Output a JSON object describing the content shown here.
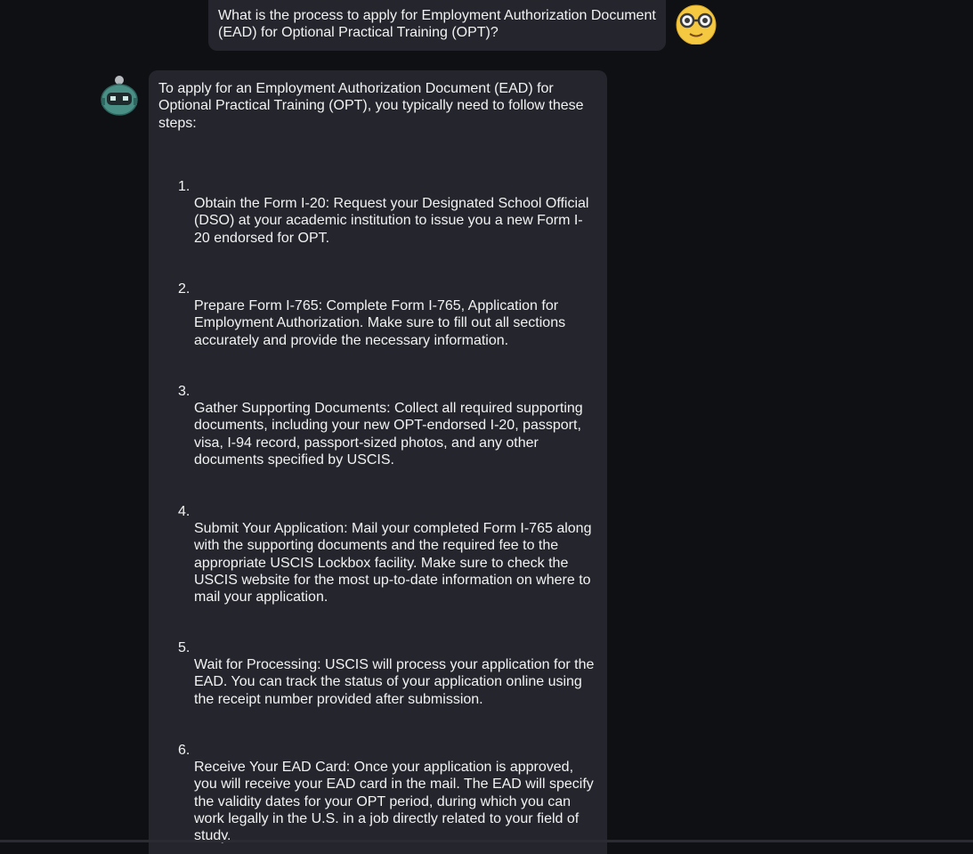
{
  "conversation": {
    "user_message": {
      "text": "What is the process to apply for Employment Authorization Document (EAD) for Optional Practical Training (OPT)?",
      "avatar_icon": "nerd-face-icon"
    },
    "assistant_message": {
      "avatar_icon": "robot-icon",
      "intro": "To apply for an Employment Authorization Document (EAD) for Optional Practical Training (OPT), you typically need to follow these steps:",
      "steps": [
        {
          "number": "1.",
          "text": "Obtain the Form I-20: Request your Designated School Official (DSO) at your academic institution to issue you a new Form I-20 endorsed for OPT."
        },
        {
          "number": "2.",
          "text": "Prepare Form I-765: Complete Form I-765, Application for Employment Authorization. Make sure to fill out all sections accurately and provide the necessary information."
        },
        {
          "number": "3.",
          "text": "Gather Supporting Documents: Collect all required supporting documents, including your new OPT-endorsed I-20, passport, visa, I-94 record, passport-sized photos, and any other documents specified by USCIS."
        },
        {
          "number": "4.",
          "text": "Submit Your Application: Mail your completed Form I-765 along with the supporting documents and the required fee to the appropriate USCIS Lockbox facility. Make sure to check the USCIS website for the most up-to-date information on where to mail your application."
        },
        {
          "number": "5.",
          "text": "Wait for Processing: USCIS will process your application for the EAD. You can track the status of your application online using the receipt number provided after submission."
        },
        {
          "number": "6.",
          "text": "Receive Your EAD Card: Once your application is approved, you will receive your EAD card in the mail. The EAD will specify the validity dates for your OPT period, during which you can work legally in the U.S. in a job directly related to your field of study."
        }
      ]
    }
  },
  "colors": {
    "background": "#0f1014",
    "bubble": "#25262d",
    "text": "#f2f2f2",
    "user_avatar": "#f5c842",
    "bot_avatar": "#4a8f86"
  }
}
